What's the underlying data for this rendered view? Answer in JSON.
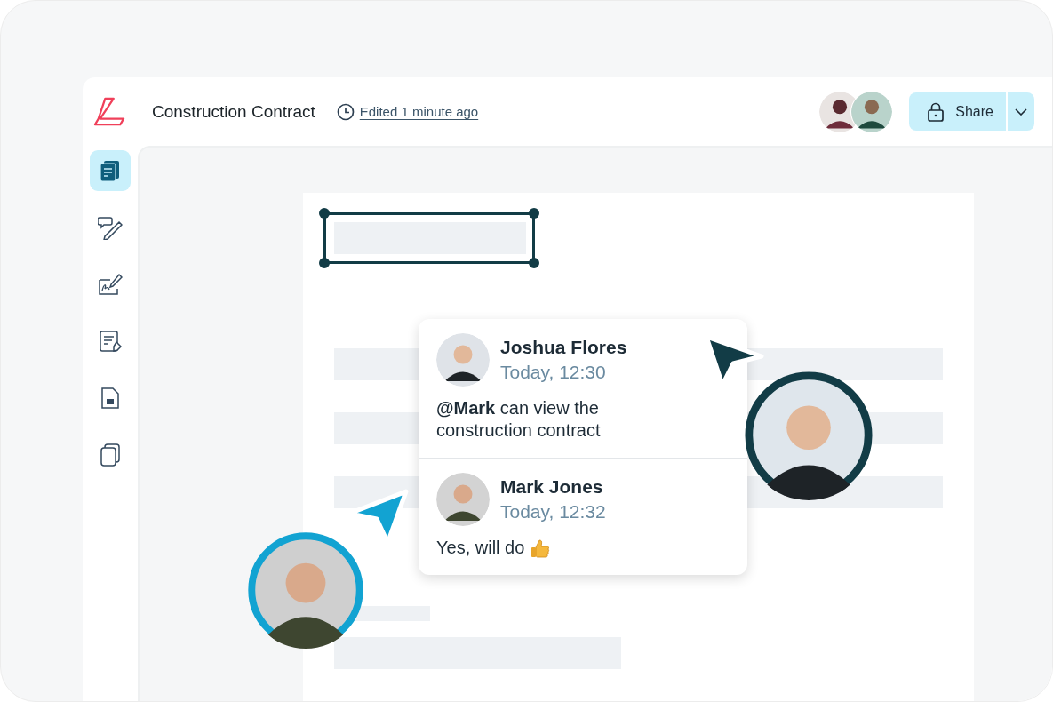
{
  "header": {
    "title": "Construction Contract",
    "edited": "Edited 1 minute ago",
    "share_label": "Share"
  },
  "sidebar": {
    "items": [
      {
        "kind": "documents",
        "selected": true
      },
      {
        "kind": "comment-edit",
        "selected": false
      },
      {
        "kind": "signature",
        "selected": false
      },
      {
        "kind": "form",
        "selected": false
      },
      {
        "kind": "file",
        "selected": false
      },
      {
        "kind": "copy",
        "selected": false
      }
    ]
  },
  "comments": [
    {
      "author": "Joshua Flores",
      "time": "Today, 12:30",
      "text": "**@Mark** can view the construction contract",
      "reaction": false
    },
    {
      "author": "Mark Jones",
      "time": "Today, 12:32",
      "text": "Yes, will do",
      "reaction": true
    }
  ]
}
